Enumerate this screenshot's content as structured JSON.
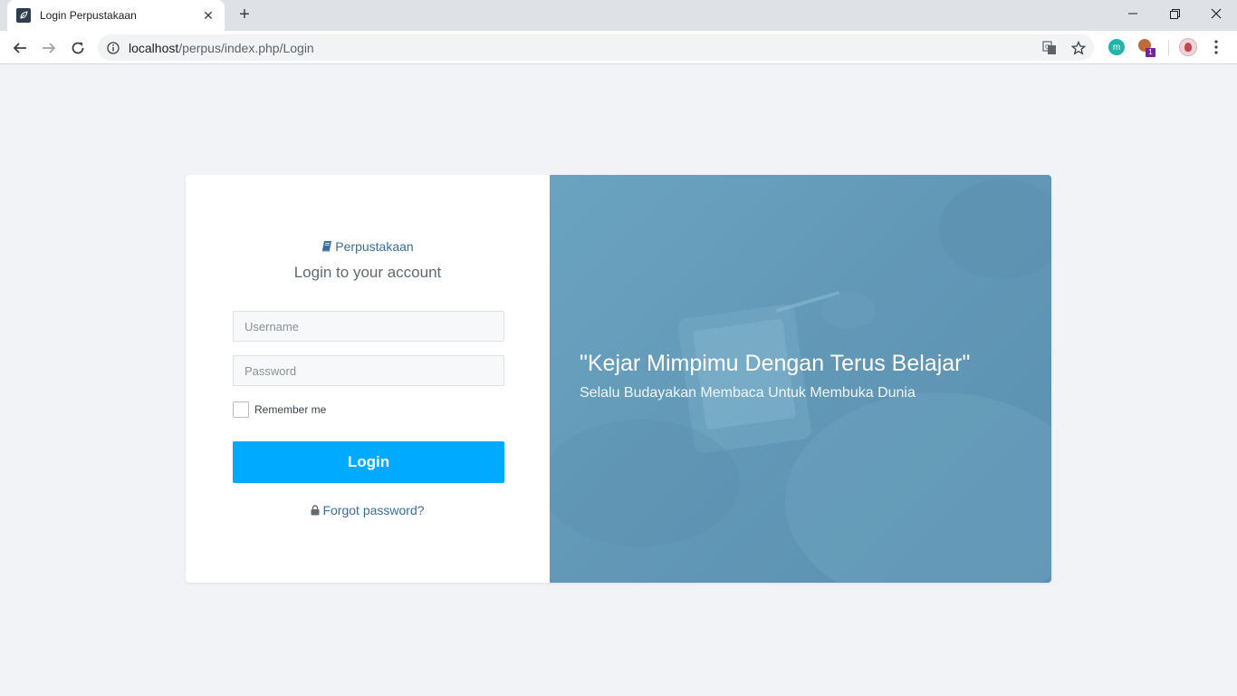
{
  "browser": {
    "tab_title": "Login Perpustakaan",
    "tab_close": "✕",
    "new_tab": "+",
    "url_host": "localhost",
    "url_path": "/perpus/index.php/Login",
    "extension_badge": "1",
    "extension_m_label": "m"
  },
  "login": {
    "brand": "Perpustakaan",
    "subtitle": "Login to your account",
    "username_placeholder": "Username",
    "password_placeholder": "Password",
    "remember_label": "Remember me",
    "login_button": "Login",
    "forgot_link": "Forgot password?"
  },
  "hero": {
    "quote": "\"Kejar Mimpimu Dengan Terus Belajar\"",
    "tagline": "Selalu Budayakan Membaca Untuk Membuka Dunia"
  },
  "colors": {
    "accent": "#00aaff",
    "link": "#3a6d9c",
    "hero_bg": "#6298b6",
    "page_bg": "#f2f3f6"
  }
}
